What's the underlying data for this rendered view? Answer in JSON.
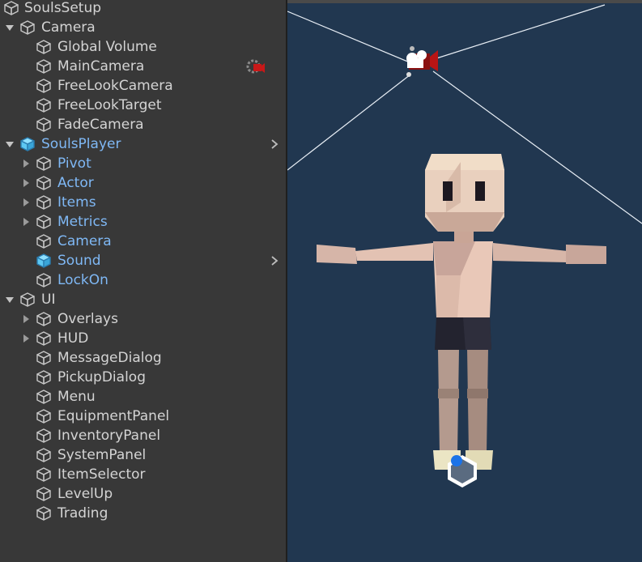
{
  "hierarchy": {
    "items": [
      {
        "label": "SoulsSetup",
        "depth": 0,
        "arrow": "none",
        "prefab": false,
        "icon": "scene-icon"
      },
      {
        "label": "Camera",
        "depth": 0,
        "arrow": "down",
        "prefab": false,
        "icon": "gameobject-icon"
      },
      {
        "label": "Global Volume",
        "depth": 1,
        "arrow": "none",
        "prefab": false,
        "icon": "gameobject-icon"
      },
      {
        "label": "MainCamera",
        "depth": 1,
        "arrow": "none",
        "prefab": false,
        "icon": "gameobject-icon",
        "badge": "camera-gear-icon"
      },
      {
        "label": "FreeLookCamera",
        "depth": 1,
        "arrow": "none",
        "prefab": false,
        "icon": "gameobject-icon"
      },
      {
        "label": "FreeLookTarget",
        "depth": 1,
        "arrow": "none",
        "prefab": false,
        "icon": "gameobject-icon"
      },
      {
        "label": "FadeCamera",
        "depth": 1,
        "arrow": "none",
        "prefab": false,
        "icon": "gameobject-icon"
      },
      {
        "label": "SoulsPlayer",
        "depth": 0,
        "arrow": "down",
        "prefab": true,
        "icon": "prefab-icon",
        "chevron": true
      },
      {
        "label": "Pivot",
        "depth": 1,
        "arrow": "right",
        "prefab": true,
        "icon": "gameobject-icon"
      },
      {
        "label": "Actor",
        "depth": 1,
        "arrow": "right",
        "prefab": true,
        "icon": "gameobject-icon"
      },
      {
        "label": "Items",
        "depth": 1,
        "arrow": "right",
        "prefab": true,
        "icon": "gameobject-icon"
      },
      {
        "label": "Metrics",
        "depth": 1,
        "arrow": "right",
        "prefab": true,
        "icon": "gameobject-icon"
      },
      {
        "label": "Camera",
        "depth": 1,
        "arrow": "none",
        "prefab": true,
        "icon": "gameobject-icon"
      },
      {
        "label": "Sound",
        "depth": 1,
        "arrow": "none",
        "prefab": true,
        "icon": "prefab-icon",
        "chevron": true
      },
      {
        "label": "LockOn",
        "depth": 1,
        "arrow": "none",
        "prefab": true,
        "icon": "gameobject-icon"
      },
      {
        "label": "UI",
        "depth": 0,
        "arrow": "down",
        "prefab": false,
        "icon": "gameobject-icon"
      },
      {
        "label": "Overlays",
        "depth": 1,
        "arrow": "right",
        "prefab": false,
        "icon": "gameobject-icon"
      },
      {
        "label": "HUD",
        "depth": 1,
        "arrow": "right",
        "prefab": false,
        "icon": "gameobject-icon"
      },
      {
        "label": "MessageDialog",
        "depth": 1,
        "arrow": "none",
        "prefab": false,
        "icon": "gameobject-icon"
      },
      {
        "label": "PickupDialog",
        "depth": 1,
        "arrow": "none",
        "prefab": false,
        "icon": "gameobject-icon"
      },
      {
        "label": "Menu",
        "depth": 1,
        "arrow": "none",
        "prefab": false,
        "icon": "gameobject-icon"
      },
      {
        "label": "EquipmentPanel",
        "depth": 1,
        "arrow": "none",
        "prefab": false,
        "icon": "gameobject-icon"
      },
      {
        "label": "InventoryPanel",
        "depth": 1,
        "arrow": "none",
        "prefab": false,
        "icon": "gameobject-icon"
      },
      {
        "label": "SystemPanel",
        "depth": 1,
        "arrow": "none",
        "prefab": false,
        "icon": "gameobject-icon"
      },
      {
        "label": "ItemSelector",
        "depth": 1,
        "arrow": "none",
        "prefab": false,
        "icon": "gameobject-icon"
      },
      {
        "label": "LevelUp",
        "depth": 1,
        "arrow": "none",
        "prefab": false,
        "icon": "gameobject-icon"
      },
      {
        "label": "Trading",
        "depth": 1,
        "arrow": "none",
        "prefab": false,
        "icon": "gameobject-icon"
      }
    ]
  },
  "scene_view": {
    "background_color": "#213750",
    "gizmos": [
      "camera-gizmo-icon",
      "frustum-lines",
      "character-model",
      "cinemachine-target-icon"
    ]
  },
  "colors": {
    "panel_bg": "#383838",
    "text": "#d4d4d4",
    "prefab_text": "#7fb8f5",
    "prefab_icon": "#5ec8f2"
  }
}
